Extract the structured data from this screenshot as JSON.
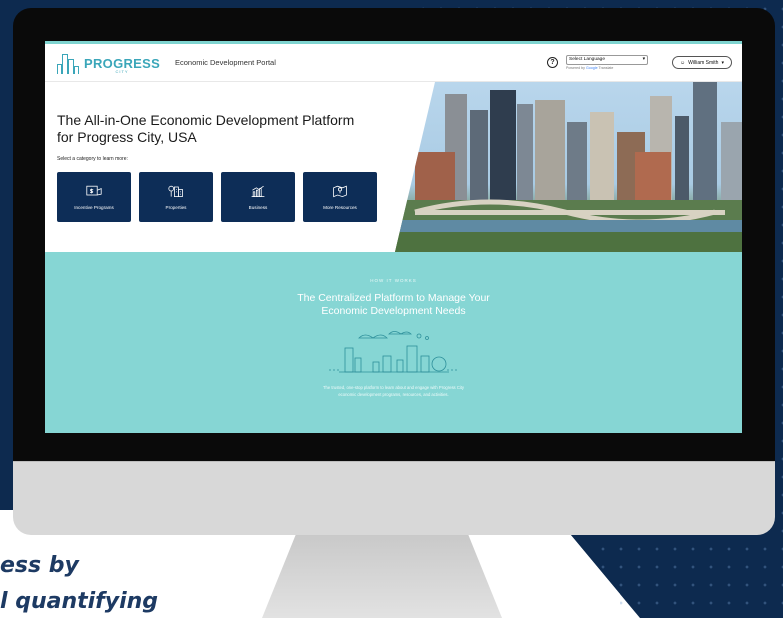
{
  "tagline": {
    "line1": "ess by",
    "line2": "l quantifying"
  },
  "portal": {
    "logo": {
      "word": "PROGRESS",
      "sub": "CITY"
    },
    "title": "Economic Development Portal",
    "help_symbol": "?",
    "language": {
      "selected": "Select Language",
      "powered_prefix": "Powered by",
      "powered_brand": "Google",
      "powered_suffix": "Translate"
    },
    "user": {
      "name": "William Smith",
      "caret": "▾"
    }
  },
  "hero": {
    "title_line1": "The All-in-One Economic Development Platform",
    "title_line2": "for Progress City, USA",
    "subtitle": "Select a category to learn more:",
    "categories": [
      {
        "label": "Incentive Programs",
        "icon": "dollar-document-icon"
      },
      {
        "label": "Properties",
        "icon": "buildings-icon"
      },
      {
        "label": "Business",
        "icon": "bar-chart-icon"
      },
      {
        "label": "More Resources",
        "icon": "map-pin-icon"
      }
    ]
  },
  "how_it_works": {
    "kicker": "HOW IT WORKS",
    "title_line1": "The Centralized Platform to Manage Your",
    "title_line2": "Economic Development Needs",
    "desc_line1": "The trusted, one-stop platform to learn about and engage with Progress City",
    "desc_line2": "economic development programs, resources, and activities."
  },
  "colors": {
    "navy": "#0d2a4f",
    "button_navy": "#0d2d57",
    "teal": "#86d6d4",
    "logo_teal": "#3aa6b9"
  }
}
